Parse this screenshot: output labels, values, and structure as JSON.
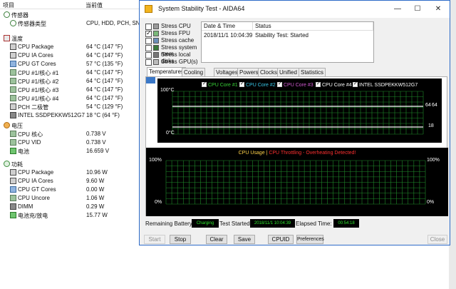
{
  "tree": {
    "header": {
      "item": "项目",
      "value": "当前值"
    },
    "groups": [
      {
        "label": "传感器",
        "rows": [
          {
            "label": "传感器类型",
            "value": "CPU, HDD, PCH, SNB"
          }
        ]
      },
      {
        "label": "温度",
        "rows": [
          {
            "label": "CPU Package",
            "value": "64 °C  (147 °F)"
          },
          {
            "label": "CPU IA Cores",
            "value": "64 °C  (147 °F)"
          },
          {
            "label": "CPU GT Cores",
            "value": "57 °C  (135 °F)"
          },
          {
            "label": "CPU #1/核心 #1",
            "value": "64 °C  (147 °F)"
          },
          {
            "label": "CPU #1/核心 #2",
            "value": "64 °C  (147 °F)"
          },
          {
            "label": "CPU #1/核心 #3",
            "value": "64 °C  (147 °F)"
          },
          {
            "label": "CPU #1/核心 #4",
            "value": "64 °C  (147 °F)"
          },
          {
            "label": "PCH 二极管",
            "value": "54 °C  (129 °F)"
          },
          {
            "label": "INTEL SSDPEKKW512G7",
            "value": "18 °C  (64 °F)"
          }
        ]
      },
      {
        "label": "电压",
        "rows": [
          {
            "label": "CPU 核心",
            "value": "0.738 V"
          },
          {
            "label": "CPU VID",
            "value": "0.738 V"
          },
          {
            "label": "电池",
            "value": "16.659 V"
          }
        ]
      },
      {
        "label": "功耗",
        "rows": [
          {
            "label": "CPU Package",
            "value": "10.96 W"
          },
          {
            "label": "CPU IA Cores",
            "value": "9.60 W"
          },
          {
            "label": "CPU GT Cores",
            "value": "0.00 W"
          },
          {
            "label": "CPU Uncore",
            "value": "1.06 W"
          },
          {
            "label": "DIMM",
            "value": "0.29 W"
          },
          {
            "label": "电池充/放电",
            "value": "15.77 W"
          }
        ]
      }
    ]
  },
  "window": {
    "title": "System Stability Test - AIDA64",
    "controls": {
      "minimize": "—",
      "maximize": "☐",
      "close": "✕"
    },
    "stress_options": [
      {
        "label": "Stress CPU",
        "checked": false
      },
      {
        "label": "Stress FPU",
        "checked": true
      },
      {
        "label": "Stress cache",
        "checked": false
      },
      {
        "label": "Stress system mem",
        "checked": false
      },
      {
        "label": "Stress local disks",
        "checked": false
      },
      {
        "label": "Stress GPU(s)",
        "checked": false
      }
    ],
    "log": {
      "col_datetime": "Date & Time",
      "col_status": "Status",
      "rows": [
        {
          "datetime": "2018/11/1 10:04:39",
          "status": "Stability Test: Started"
        }
      ]
    },
    "tabs": [
      "Temperatures",
      "Cooling Fans",
      "Voltages",
      "Powers",
      "Clocks",
      "Unified",
      "Statistics"
    ],
    "active_tab": "Temperatures",
    "temp_chart": {
      "legend": [
        {
          "name": "CPU Core #1",
          "color": "#38d238"
        },
        {
          "name": "CPU Core #2",
          "color": "#38c7e8"
        },
        {
          "name": "CPU Core #3",
          "color": "#d25ad2"
        },
        {
          "name": "CPU Core #4",
          "color": "#ffffff"
        },
        {
          "name": "INTEL SSDPEKKW512G7",
          "color": "#ffffff"
        }
      ],
      "y_top": "100°C",
      "y_bottom": "0°C",
      "right_top_value": "64",
      "right_top_value_2": "64",
      "right_bottom_value": "18"
    },
    "usage_chart": {
      "title_part1": "CPU Usage",
      "separator": "|",
      "title_part2": "CPU Throttling - Overheating Detected!",
      "y_top_left": "100%",
      "y_bottom_left": "0%",
      "y_top_right": "100%",
      "y_bottom_right": "0%"
    },
    "status": {
      "battery_label": "Remaining Battery:",
      "battery_value": "Charging",
      "started_label": "Test Started:",
      "started_value": "2018/11/1 10:04:39",
      "elapsed_label": "Elapsed Time:",
      "elapsed_value": "00:54:18"
    },
    "buttons": {
      "start": "Start",
      "stop": "Stop",
      "clear": "Clear",
      "save": "Save",
      "cpuid": "CPUID",
      "preferences": "Preferences",
      "close": "Close"
    },
    "colors": {
      "grid": "#1f8a2a",
      "line": "#ffffff",
      "usage_title": "#ffd24a",
      "throttle": "#ff3030",
      "status_text": "#2fe82f"
    }
  }
}
